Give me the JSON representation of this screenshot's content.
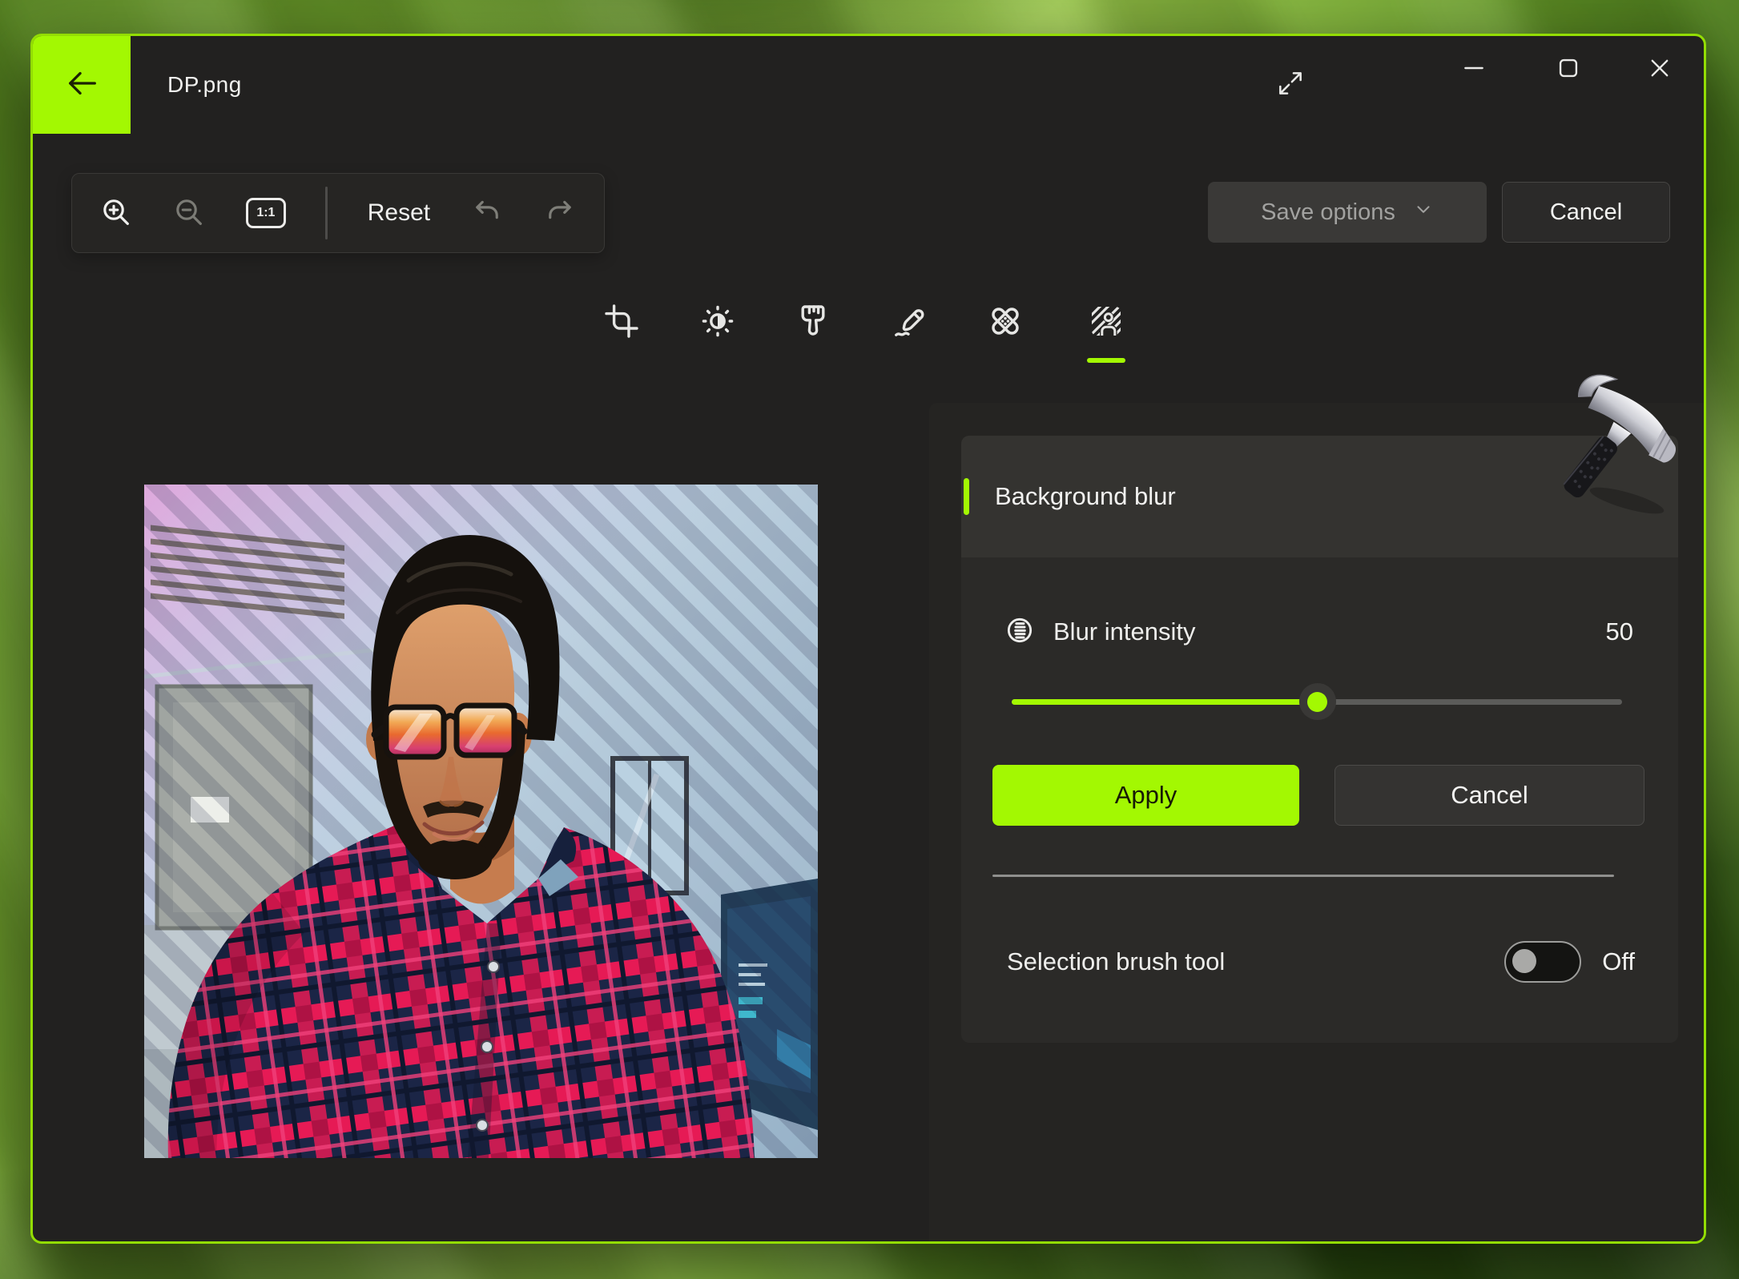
{
  "titlebar": {
    "title": "DP.png",
    "back_icon": "arrow-left-icon",
    "fullscreen_icon": "expand-diagonal-icon",
    "minimize_icon": "minimize-icon",
    "maximize_icon": "maximize-icon",
    "close_icon": "close-icon"
  },
  "toolbar": {
    "zoom_in_icon": "zoom-in-icon",
    "zoom_out_icon": "zoom-out-icon",
    "actual_size_label": "1:1",
    "reset_label": "Reset",
    "undo_icon": "undo-icon",
    "redo_icon": "redo-icon"
  },
  "header_actions": {
    "save_options_label": "Save options",
    "save_options_enabled": false,
    "save_chevron_icon": "chevron-down-icon",
    "cancel_label": "Cancel"
  },
  "tabs": [
    {
      "id": "crop",
      "icon": "crop-icon",
      "selected": false
    },
    {
      "id": "adjustment",
      "icon": "brightness-icon",
      "selected": false
    },
    {
      "id": "filter",
      "icon": "paintbrush-icon",
      "selected": false
    },
    {
      "id": "markup",
      "icon": "pen-icon",
      "selected": false
    },
    {
      "id": "retouch",
      "icon": "bandage-icon",
      "selected": false
    },
    {
      "id": "background",
      "icon": "background-person-icon",
      "selected": true
    }
  ],
  "canvas": {
    "description": "Selfie photo; diagonal stripe mask shows blur selection over background"
  },
  "panel": {
    "title": "Background blur",
    "blur_icon": "blur-intensity-icon",
    "blur_label": "Blur intensity",
    "blur_value": "50",
    "slider": {
      "min": 0,
      "max": 100,
      "value": 50
    },
    "apply_label": "Apply",
    "cancel_label": "Cancel",
    "selection_brush_label": "Selection brush tool",
    "selection_brush_state": "Off"
  },
  "cursor": {
    "icon": "hammer-cursor-icon"
  },
  "colors": {
    "accent": "#a3f802",
    "window_border": "#93dd04",
    "window_bg": "#222120",
    "panel_bg": "#252422",
    "card_bg": "#2b2a28",
    "card_header_bg": "#343330"
  }
}
